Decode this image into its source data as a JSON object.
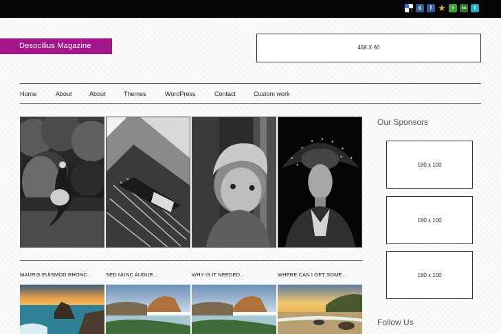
{
  "topbar": {
    "social_icons": [
      {
        "name": "delicious-icon",
        "glyph": ""
      },
      {
        "name": "digg-icon",
        "glyph": "d"
      },
      {
        "name": "facebook-icon",
        "glyph": "f"
      },
      {
        "name": "star-icon",
        "glyph": "★"
      },
      {
        "name": "plus-icon",
        "glyph": "+"
      },
      {
        "name": "stumbleupon-icon",
        "glyph": "su"
      },
      {
        "name": "twitter-icon",
        "glyph": "t"
      }
    ]
  },
  "header": {
    "logo_text": "Desocilius Magazine",
    "ad_label": "468 X 60"
  },
  "nav": {
    "items": [
      "Home",
      "About",
      "About",
      "Themes",
      "WordPress",
      "Contact",
      "Custom work"
    ]
  },
  "featured": {
    "images": [
      {
        "alt": "woman-running-bw"
      },
      {
        "alt": "architecture-bw"
      },
      {
        "alt": "child-portrait-bw"
      },
      {
        "alt": "woman-headdress-bw"
      }
    ]
  },
  "posts": [
    {
      "title": "MAURIS EUISMOD RHONC..."
    },
    {
      "title": "SED NUNC AUGUE..."
    },
    {
      "title": "WHY IS IT NEEDED..."
    },
    {
      "title": "WHERE CAN I GET SOME..."
    }
  ],
  "sidebar": {
    "sponsors_heading": "Our Sponsors",
    "sponsor_labels": [
      "180 x 100",
      "180 x 100",
      "180 x 100"
    ],
    "follow_heading": "Follow Us"
  },
  "colors": {
    "brand": "#a3178a",
    "topbar": "#050505"
  }
}
